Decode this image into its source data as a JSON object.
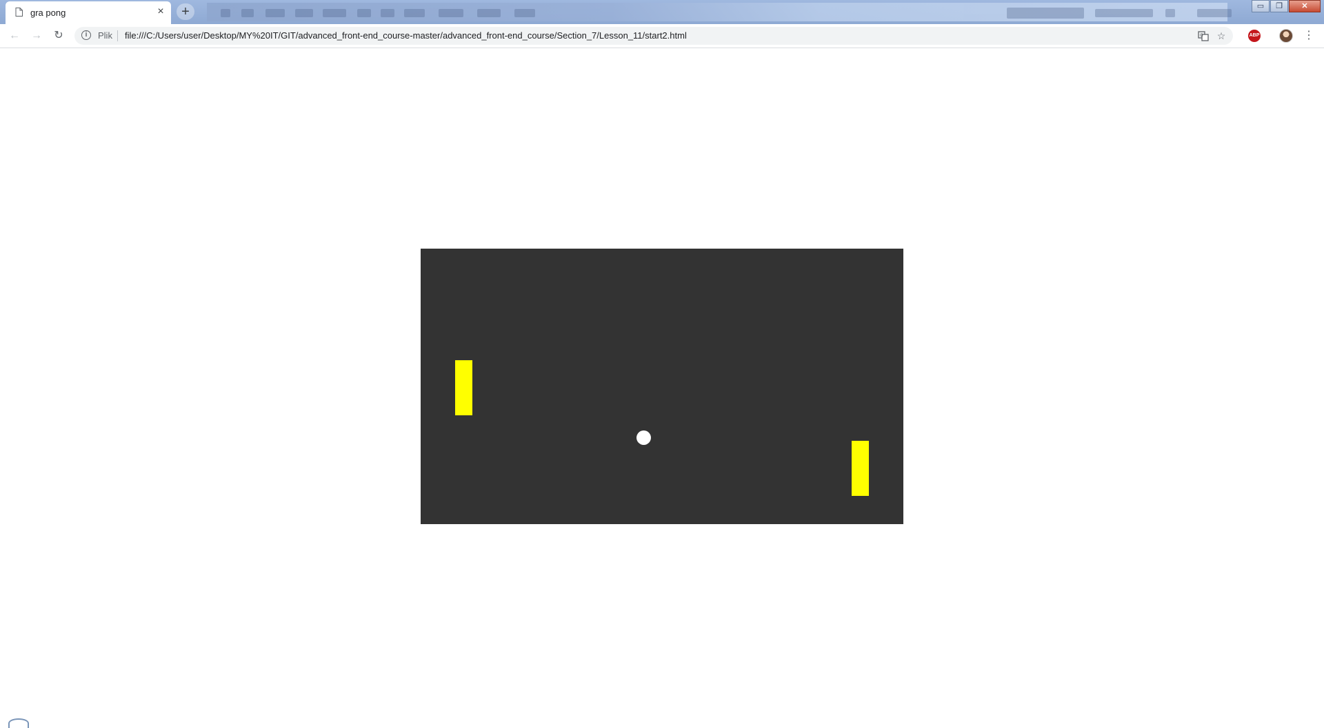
{
  "browser": {
    "tab": {
      "title": "gra pong",
      "icon": "page-icon",
      "close_icon": "close-icon"
    },
    "new_tab_icon": "plus-icon",
    "window_controls": {
      "minimize": "▭",
      "restore": "❐",
      "close": "✕"
    },
    "nav": {
      "back_icon": "←",
      "forward_icon": "→",
      "reload_icon": "↻"
    },
    "omnibox": {
      "security_label": "Plik",
      "url": "file:///C:/Users/user/Desktop/MY%20IT/GIT/advanced_front-end_course-master/advanced_front-end_course/Section_7/Lesson_11/start2.html"
    },
    "toolbar_right": {
      "translate_icon": "translate-icon",
      "bookmark_icon": "☆",
      "adblock_label": "ABP",
      "menu_icon": "⋮"
    }
  },
  "game": {
    "background_color": "#333333",
    "paddle_color": "#ffff00",
    "ball_color": "#ffffff"
  }
}
